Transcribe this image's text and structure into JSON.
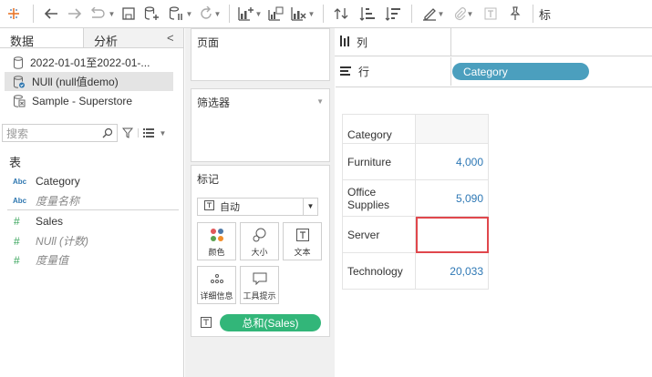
{
  "toolbar": {
    "icons": [
      "tableau-logo-icon",
      "back-icon",
      "forward-icon",
      "redo-icon",
      "save-icon",
      "new-datasource-icon",
      "pause-update-icon",
      "refresh-icon",
      "new-sheet-icon",
      "duplicate-sheet-icon",
      "clear-sheet-icon",
      "swap-icon",
      "sort-asc-icon",
      "sort-desc-icon",
      "highlight-icon",
      "attach-icon",
      "text-label-icon",
      "pin-icon"
    ],
    "cut_label": "标"
  },
  "left_panel": {
    "tab_data": "数据",
    "tab_analysis": "分析",
    "collapse": "<",
    "datasources": [
      {
        "label": "2022-01-01至2022-01-...",
        "icon": "cylinder-icon"
      },
      {
        "label": "NUll (null值demo)",
        "icon": "cylinder-check-icon"
      },
      {
        "label": "Sample - Superstore",
        "icon": "excel-source-icon"
      }
    ],
    "search_placeholder": "搜索",
    "table_header": "表",
    "fields": [
      {
        "type": "Abc",
        "label": "Category",
        "italic": false
      },
      {
        "type": "Abc",
        "label": "度量名称",
        "italic": true
      },
      {
        "type": "#",
        "label": "Sales",
        "italic": false
      },
      {
        "type": "#",
        "label": "NUll (计数)",
        "italic": true
      },
      {
        "type": "#",
        "label": "度量值",
        "italic": true
      }
    ]
  },
  "middle": {
    "pages": "页面",
    "filters": "筛选器",
    "marks": "标记",
    "mark_type": "自动",
    "mark_buttons": [
      "颜色",
      "大小",
      "文本",
      "详细信息",
      "工具提示"
    ],
    "text_pill": "总和(Sales)",
    "pill_color": "#32b679"
  },
  "shelves": {
    "columns_label": "列",
    "rows_label": "行",
    "rows_pill": "Category",
    "rows_pill_color": "#4b9fbe"
  },
  "viz": {
    "header": "Category",
    "rows": [
      {
        "category": "Furniture",
        "value": "4,000"
      },
      {
        "category": "Office Supplies",
        "value": "5,090"
      },
      {
        "category": "Server",
        "value": ""
      },
      {
        "category": "Technology",
        "value": "20,033"
      }
    ],
    "highlight_color": "#e0474c",
    "value_color": "#2e78b5"
  }
}
